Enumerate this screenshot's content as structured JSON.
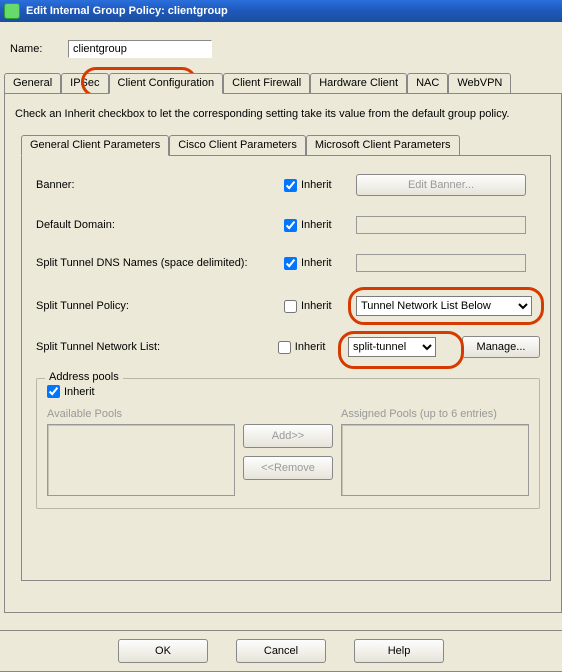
{
  "window": {
    "title": "Edit Internal Group Policy: clientgroup"
  },
  "name_field": {
    "label": "Name:",
    "value": "clientgroup"
  },
  "outer_tabs": {
    "general": "General",
    "ipsec": "IPSec",
    "client_config": "Client Configuration",
    "client_firewall": "Client Firewall",
    "hardware_client": "Hardware Client",
    "nac": "NAC",
    "webvpn": "WebVPN"
  },
  "instruction": "Check an Inherit checkbox to let the corresponding setting take its value from the default group policy.",
  "inner_tabs": {
    "general": "General Client Parameters",
    "cisco": "Cisco Client Parameters",
    "microsoft": "Microsoft Client Parameters"
  },
  "rows": {
    "inherit_label": "Inherit",
    "banner": {
      "label": "Banner:",
      "btn": "Edit Banner..."
    },
    "default_domain": {
      "label": "Default Domain:"
    },
    "split_dns": {
      "label": "Split Tunnel DNS Names (space delimited):"
    },
    "split_policy": {
      "label": "Split Tunnel Policy:",
      "value": "Tunnel Network List Below"
    },
    "split_nl": {
      "label": "Split Tunnel Network List:",
      "value": "split-tunnel",
      "manage_btn": "Manage..."
    }
  },
  "address_pools": {
    "title": "Address pools",
    "inherit_label": "Inherit",
    "available_label": "Available Pools",
    "assigned_label": "Assigned Pools (up to 6 entries)",
    "add_btn": "Add>>",
    "remove_btn": "<<Remove"
  },
  "bottom": {
    "ok": "OK",
    "cancel": "Cancel",
    "help": "Help"
  }
}
